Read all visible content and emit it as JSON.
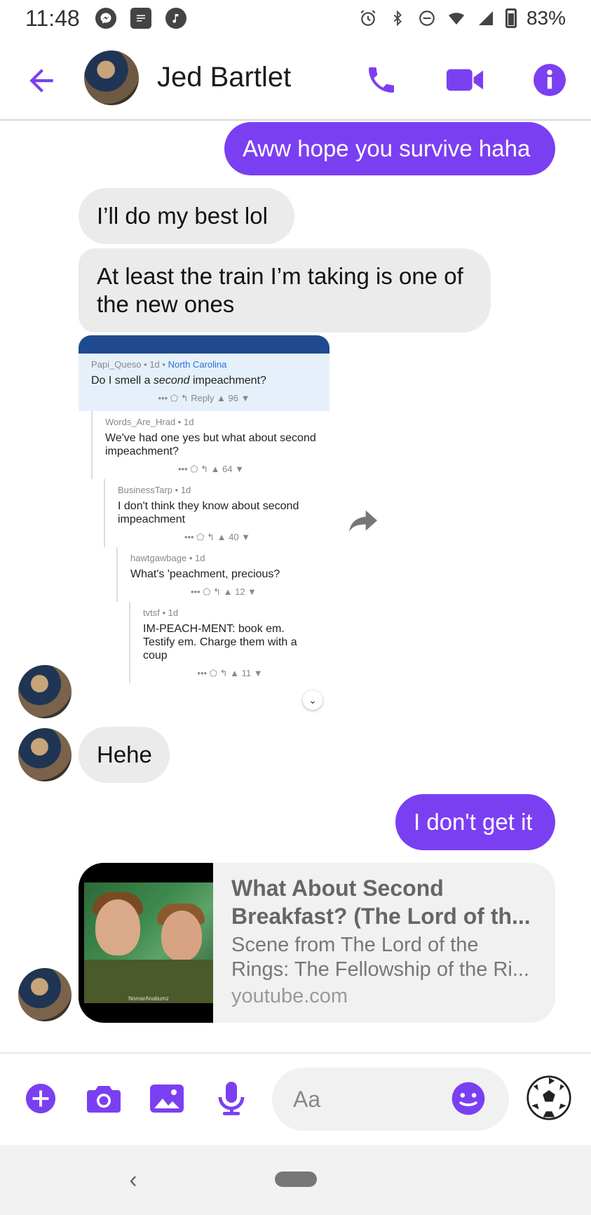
{
  "status_bar": {
    "time": "11:48",
    "battery": "83%",
    "left_icons": [
      "messenger-icon",
      "news-icon",
      "music-icon"
    ],
    "right_icons": [
      "alarm-icon",
      "bluetooth-icon",
      "dnd-icon",
      "wifi-icon",
      "signal-icon",
      "battery-icon"
    ]
  },
  "header": {
    "contact_name": "Jed Bartlet",
    "accent_color": "#7b3ff2"
  },
  "messages": [
    {
      "direction": "out",
      "text": "Aww hope you survive haha"
    },
    {
      "direction": "in",
      "text": "I’ll do my best lol"
    },
    {
      "direction": "in",
      "text": "At least the train I’m taking is one of the new ones"
    },
    {
      "direction": "in",
      "text": "Hehe"
    },
    {
      "direction": "out",
      "text": "I don't get it"
    }
  ],
  "shared_screenshot": {
    "post": {
      "meta_user": "Papi_Queso • 1d •",
      "meta_location": "North Carolina",
      "text_before": "Do I smell a ",
      "text_italic": "second",
      "text_after": " impeachment?",
      "actions": "•••   ⬠   ↰ Reply   ▲ 96 ▼"
    },
    "comments": [
      {
        "meta": "Words_Are_Hrad • 1d",
        "text": "We've had one yes but what about second impeachment?",
        "actions": "•••   ⬠   ↰   ▲ 64 ▼"
      },
      {
        "meta": "BusinessTarp • 1d",
        "text": "I don't think they know about second impeachment",
        "actions": "•••   ⬠   ↰   ▲ 40 ▼"
      },
      {
        "meta": "hawtgawbage • 1d",
        "text": "What's 'peachment, precious?",
        "actions": "•••   ⬠   ↰   ▲ 12 ▼"
      },
      {
        "meta": "tvtsf • 1d",
        "text": "IM-PEACH-MENT: book em. Testify em. Charge them with a coup",
        "actions": "•••   ⬠   ↰   ▲ 11 ▼"
      }
    ]
  },
  "link_preview": {
    "title": "What About Second Breakfast? (The Lord of th...",
    "description": "Scene from The Lord of the Rings: The Fellowship of the Ri...",
    "domain": "youtube.com",
    "thumb_caption": "NomarAnabumz"
  },
  "composer": {
    "placeholder": "Aa"
  },
  "nav": {
    "back_glyph": "‹"
  }
}
